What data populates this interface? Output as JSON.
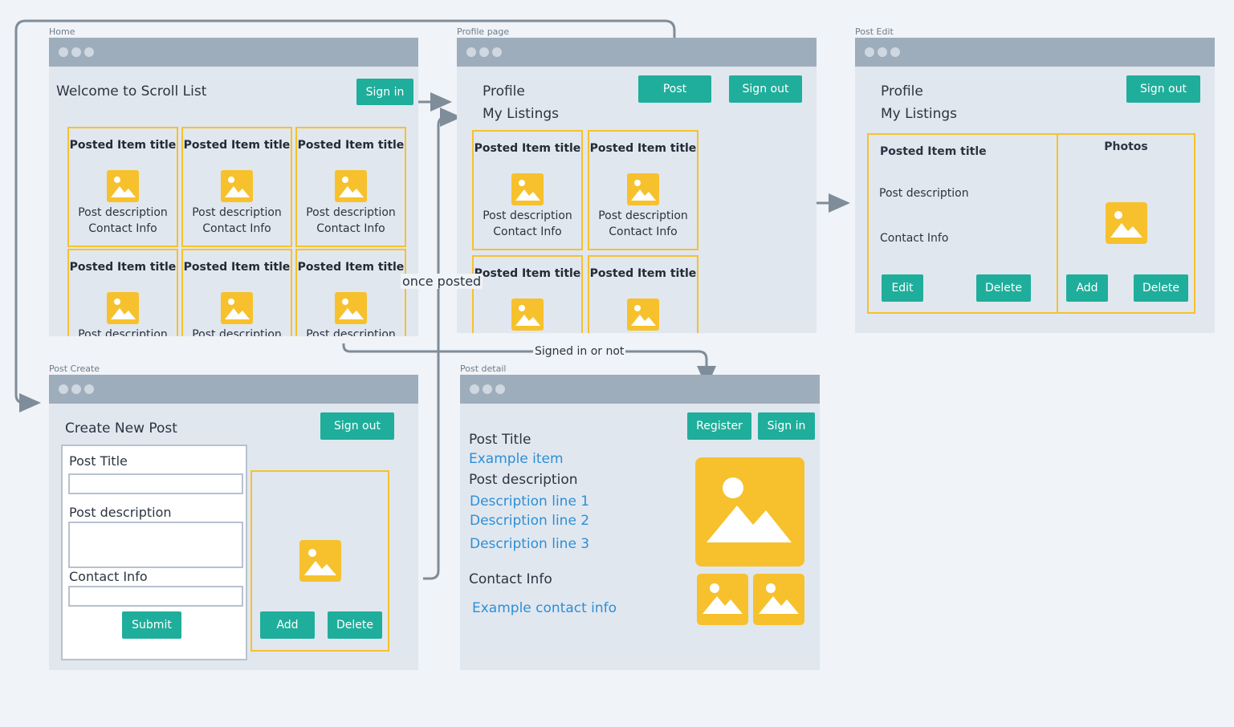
{
  "frames": {
    "home": {
      "label": "Home",
      "heading": "Welcome to Scroll List",
      "sign_in": "Sign in",
      "cards": [
        {
          "title": "Posted Item title",
          "desc": "Post description",
          "contact": "Contact Info"
        },
        {
          "title": "Posted Item title",
          "desc": "Post description",
          "contact": "Contact Info"
        },
        {
          "title": "Posted Item title",
          "desc": "Post description",
          "contact": "Contact Info"
        },
        {
          "title": "Posted Item title",
          "desc": "Post description",
          "contact": ""
        },
        {
          "title": "Posted Item title",
          "desc": "Post description",
          "contact": ""
        },
        {
          "title": "Posted Item title",
          "desc": "Post description",
          "contact": ""
        }
      ]
    },
    "profile": {
      "label": "Profile page",
      "heading": "Profile",
      "subheading": "My Listings",
      "post": "Post",
      "sign_out": "Sign out",
      "cards": [
        {
          "title": "Posted Item title",
          "desc": "Post description",
          "contact": "Contact Info"
        },
        {
          "title": "Posted Item title",
          "desc": "Post description",
          "contact": "Contact Info"
        },
        {
          "title": "Posted Item title",
          "desc": "",
          "contact": ""
        },
        {
          "title": "Posted Item title",
          "desc": "",
          "contact": ""
        }
      ]
    },
    "edit": {
      "label": "Post Edit",
      "heading": "Profile",
      "subheading": "My Listings",
      "sign_out": "Sign out",
      "item_title": "Posted Item title",
      "item_desc": "Post description",
      "item_contact": "Contact Info",
      "edit": "Edit",
      "delete": "Delete",
      "photos": "Photos",
      "add": "Add",
      "photos_delete": "Delete"
    },
    "create": {
      "label": "Post Create",
      "heading": "Create New Post",
      "sign_out": "Sign out",
      "title_label": "Post Title",
      "desc_label": "Post description",
      "contact_label": "Contact Info",
      "submit": "Submit",
      "add": "Add",
      "delete": "Delete"
    },
    "detail": {
      "label": "Post detail",
      "register": "Register",
      "sign_in": "Sign in",
      "title_label": "Post Title",
      "title_value": "Example item",
      "desc_label": "Post description",
      "desc_lines": [
        "Description line 1",
        "Description line 2",
        "Description line 3"
      ],
      "contact_label": "Contact Info",
      "contact_value": "Example contact info"
    }
  },
  "connectors": {
    "once_posted": "once posted",
    "signed_in_or_not": "Signed in or not"
  },
  "colors": {
    "background": "#f0f3f7",
    "frame": "#e1e7ef",
    "titlebar": "#9eadbb",
    "button": "#1fae9b",
    "accent_yellow": "#f6c12c",
    "link": "#2d8fd6",
    "connector": "#7f8c99"
  }
}
